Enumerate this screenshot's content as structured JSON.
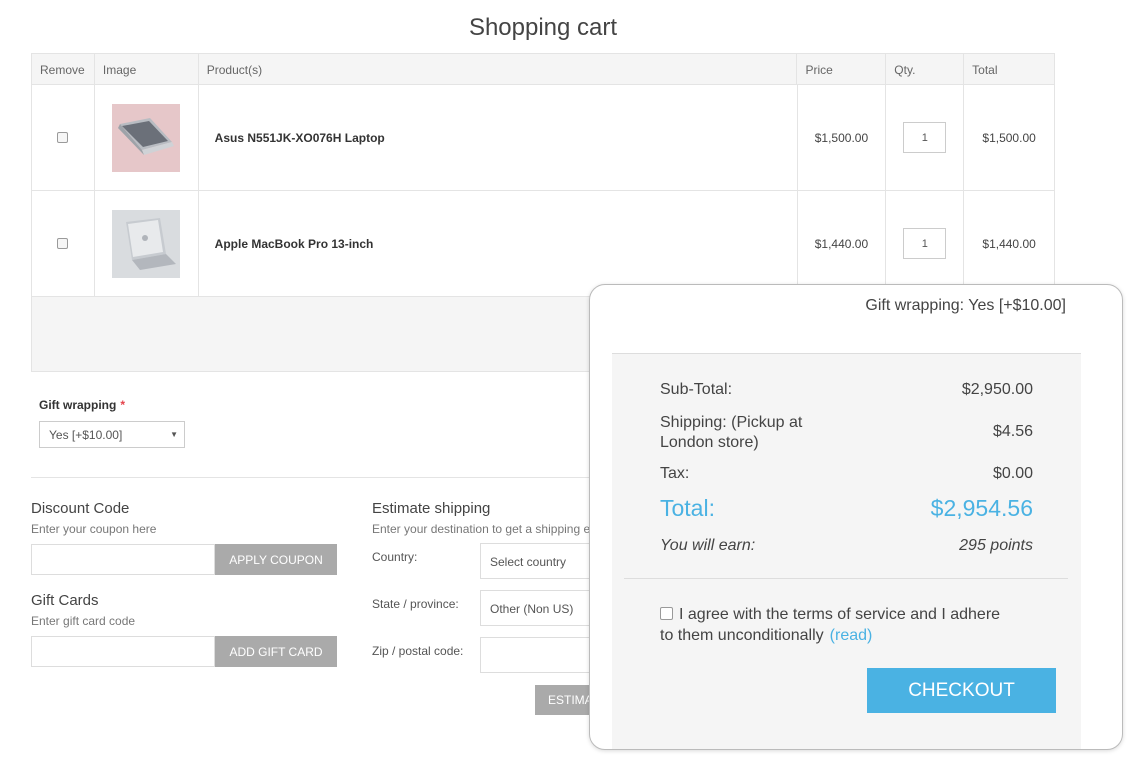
{
  "page": {
    "title": "Shopping cart"
  },
  "table": {
    "headers": {
      "remove": "Remove",
      "image": "Image",
      "product": "Product(s)",
      "price": "Price",
      "qty": "Qty.",
      "total": "Total"
    },
    "rows": [
      {
        "product": "Asus N551JK-XO076H Laptop",
        "price": "$1,500.00",
        "qty": "1",
        "total": "$1,500.00",
        "image_icon": "laptop-image"
      },
      {
        "product": "Apple MacBook Pro 13-inch",
        "price": "$1,440.00",
        "qty": "1",
        "total": "$1,440.00",
        "image_icon": "macbook-image"
      }
    ]
  },
  "gift_wrapping": {
    "label": "Gift wrapping",
    "required_mark": "*",
    "selected": "Yes [+$10.00]"
  },
  "discount": {
    "title": "Discount Code",
    "hint": "Enter your coupon here",
    "button": "APPLY COUPON"
  },
  "gift_cards": {
    "title": "Gift Cards",
    "hint": "Enter gift card code",
    "button": "ADD GIFT CARD"
  },
  "shipping": {
    "title": "Estimate shipping",
    "hint": "Enter your destination to get a shipping e",
    "country_label": "Country:",
    "country_value": "Select country",
    "state_label": "State / province:",
    "state_value": "Other (Non US)",
    "zip_label": "Zip / postal code:",
    "button": "ESTIMA"
  },
  "summary": {
    "gift_wrapping": "Gift wrapping: Yes [+$10.00]",
    "subtotal_label": "Sub-Total:",
    "subtotal_value": "$2,950.00",
    "shipping_label_1": "Shipping: (Pickup at",
    "shipping_label_2": "London store)",
    "shipping_value": "$4.56",
    "tax_label": "Tax:",
    "tax_value": "$0.00",
    "total_label": "Total:",
    "total_value": "$2,954.56",
    "earn_label": "You will earn:",
    "earn_value": "295 points",
    "terms_text_1": "I agree with the terms of service and I adhere",
    "terms_text_2": "to them unconditionally",
    "terms_link": "(read)",
    "checkout": "CHECKOUT"
  },
  "colors": {
    "accent": "#4ab2e3",
    "button_gray": "#aaaaaa",
    "required": "#e4434b"
  }
}
